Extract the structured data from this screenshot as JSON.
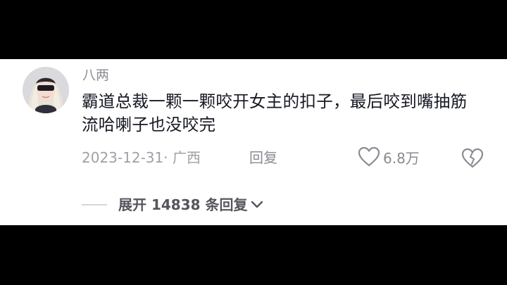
{
  "comment": {
    "username": "八两",
    "text": "霸道总裁一颗一颗咬开女主的扣子，最后咬到嘴抽筋流哈喇子也没咬完",
    "date_location": "2023-12-31· 广西",
    "reply_label": "回复",
    "like_count": "6.8万",
    "expand_label": "展开 14838 条回复"
  },
  "icons": {
    "like": "heart-outline-icon",
    "dislike": "broken-heart-icon",
    "expand": "chevron-down-icon"
  },
  "colors": {
    "background": "#000000",
    "card": "#ffffff",
    "text": "#161823",
    "muted": "#8a8a92"
  }
}
